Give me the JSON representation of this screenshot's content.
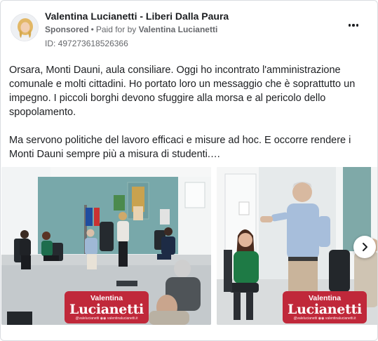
{
  "post": {
    "page_name": "Valentina Lucianetti - Liberi Dalla Paura",
    "sponsored": "Sponsored",
    "separator": "•",
    "paid_for_label": "Paid for by",
    "paid_for_name": "Valentina Lucianetti",
    "ad_id": "ID: 497273618526366",
    "paragraphs": [
      "Orsara, Monti Dauni, aula consiliare. Oggi ho incontrato l'amministrazione comunale e molti cittadini. Ho portato loro un messaggio che è soprattutto un impegno. I piccoli borghi devono sfuggire alla morsa e al pericolo dello spopolamento.",
      "Ma servono politiche del lavoro efficaci e misure ad hoc. E occorre rendere i Monti Dauni sempre più a misura di studenti.…"
    ]
  },
  "carousel": {
    "slides": [
      {
        "badge_top": "Valentina",
        "badge_main": "Lucianetti",
        "badge_sub": "@valelucianetti ◉◉ valentinalucianetti.it"
      },
      {
        "badge_top": "Valentina",
        "badge_main": "Lucianetti",
        "badge_sub": "@valelucianetti ◉◉ valentinalucianetti.it"
      }
    ],
    "next_icon": "chevron-right-icon"
  },
  "icons": {
    "more": "more-horizontal-icon",
    "avatar": "profile-picture"
  },
  "colors": {
    "badge_red": "#c0283a",
    "text_primary": "#1c1e21",
    "text_secondary": "#65676b"
  }
}
